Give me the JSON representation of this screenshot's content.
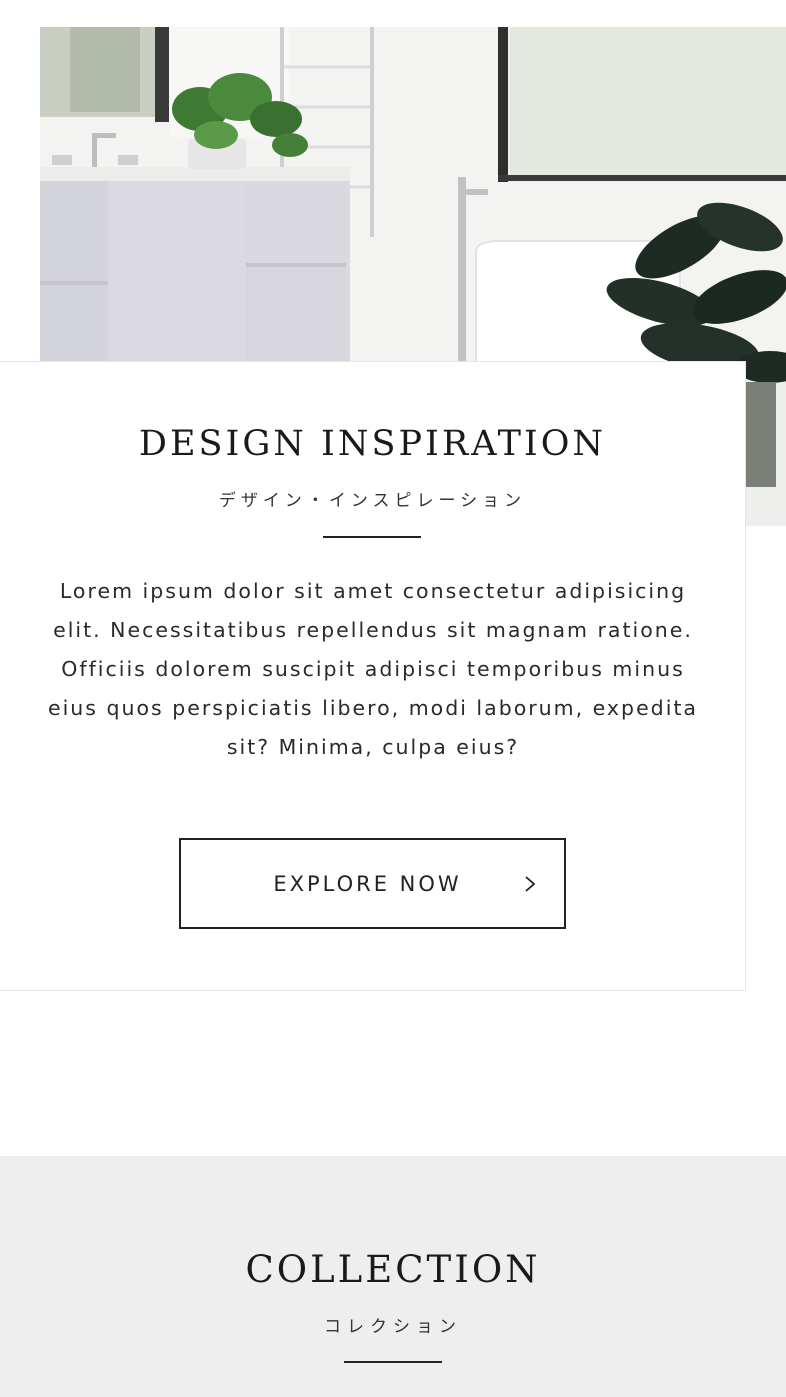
{
  "hero": {
    "image_alt": "bathroom-interior-photo"
  },
  "inspiration": {
    "title": "DESIGN INSPIRATION",
    "subtitle": "デザイン・インスピレーション",
    "body": "Lorem ipsum dolor sit amet consectetur adipisicing elit. Necessitatibus repellendus sit magnam ratione. Officiis dolorem suscipit adipisci temporibus minus eius quos perspiciatis libero, modi laborum, expedita sit? Minima, culpa eius?",
    "button_label": "EXPLORE NOW",
    "button_icon": "chevron-right-icon"
  },
  "collection": {
    "title": "COLLECTION",
    "subtitle": "コレクション"
  },
  "colors": {
    "text": "#1a1a1a",
    "section_background": "#eeeeee",
    "card_border": "#e6e6e6"
  }
}
